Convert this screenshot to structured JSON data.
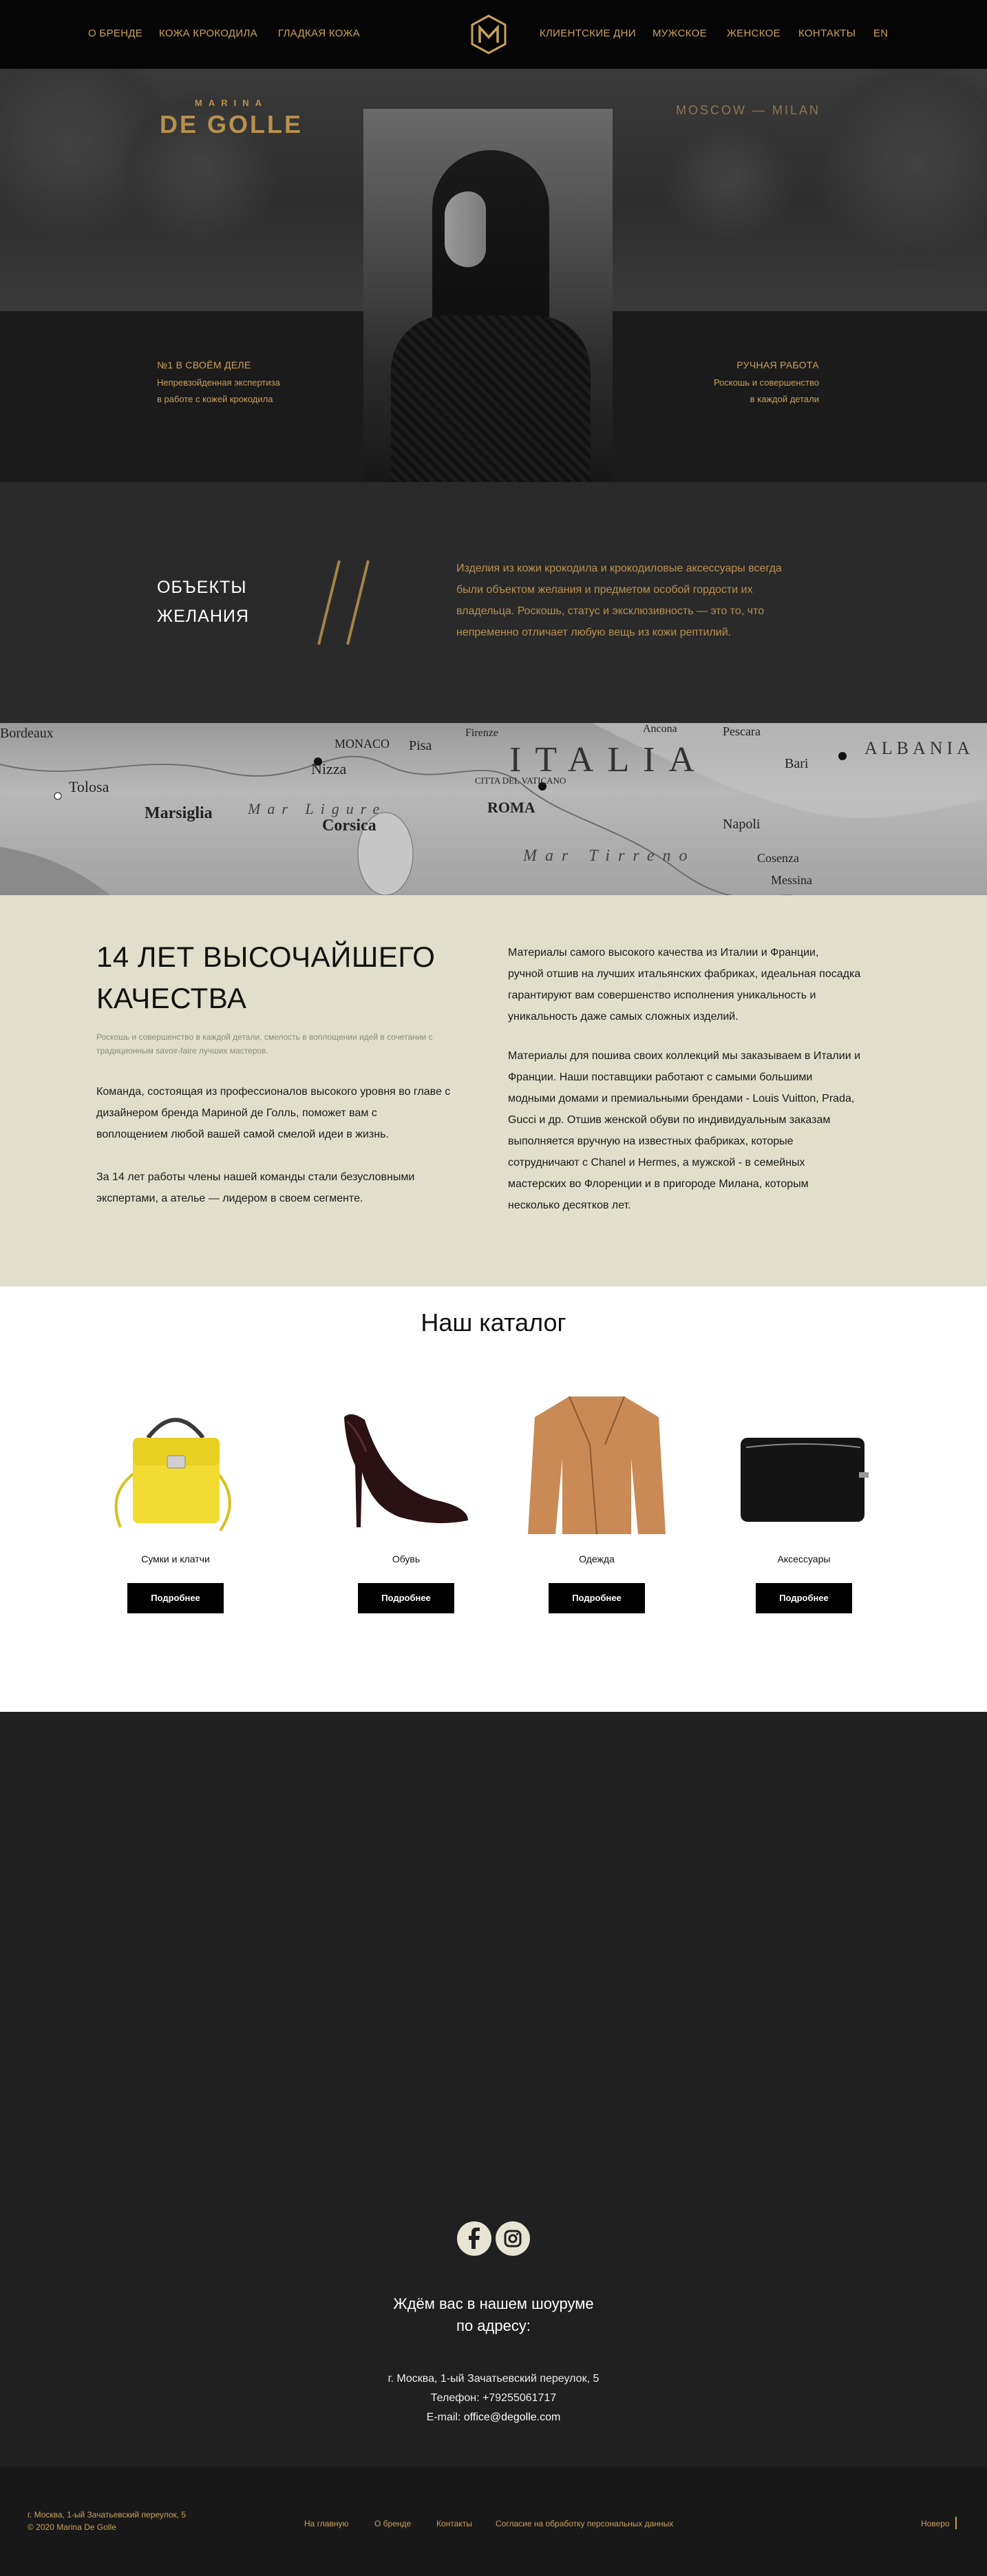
{
  "nav": {
    "left": [
      "О БРЕНДЕ",
      "КОЖА КРОКОДИЛА",
      "ГЛАДКАЯ КОЖА"
    ],
    "right": [
      "КЛИЕНТСКИЕ ДНИ",
      "МУЖСКОЕ",
      "ЖЕНСКОЕ",
      "КОНТАКТЫ",
      "EN"
    ],
    "logo_letter": "M"
  },
  "hero": {
    "brand_small": "MARINA",
    "brand_big": "DE GOLLE",
    "city": "MOSCOW — MILAN",
    "left_heading": "№1 В СВОЁМ ДЕЛЕ",
    "left_lines": [
      "Непревзойденная экспертиза",
      "в работе с кожей крокодила"
    ],
    "right_heading": "РУЧНАЯ РАБОТА",
    "right_lines": [
      "Роскошь и совершенство",
      "в каждой детали"
    ]
  },
  "objects": {
    "title_lines": [
      "ОБЪЕКТЫ",
      "ЖЕЛАНИЯ"
    ],
    "text_lines": [
      "Изделия из кожи крокодила и крокодиловые аксессуары всегда",
      "были объектом желания и предметом особой гордости их",
      "владельца. Роскошь, статус и эксклюзивность — это то, что",
      "непременно отличает любую вещь из кожи рептилий."
    ]
  },
  "map": {
    "labels": [
      "Bordeaux",
      "Tolosa",
      "Marsiglia",
      "MONACO",
      "Nizza",
      "Pisa",
      "ITALIA",
      "Corsica",
      "ROMA",
      "Napoli",
      "Bari",
      "Pescara",
      "ALBANIA",
      "Cosenza",
      "Messina",
      "Mar Tirreno",
      "Mar Ligure",
      "CITTA DEL VATICANO",
      "Firenze",
      "Ancona"
    ]
  },
  "quality": {
    "title_lines": [
      "14 ЛЕТ ВЫСОЧАЙШЕГО",
      "КАЧЕСТВА"
    ],
    "subtitle_lines": [
      "Роскошь и совершенство в каждой детали, смелость в воплощении идей в сочетании с",
      "традиционным savoir-faire лучших мастеров."
    ],
    "left_p1": [
      "Команда, состоящая из профессионалов высокого уровня во главе с",
      "дизайнером бренда Мариной де Голль, поможет вам с",
      "воплощением любой вашей самой смелой идеи в жизнь."
    ],
    "left_p2": [
      "За 14 лет работы члены нашей команды стали безусловными",
      "экспертами, а ателье — лидером в своем сегменте."
    ],
    "right_p1": [
      "Материалы самого высокого качества из Италии и Франции,",
      "ручной отшив на лучших итальянских фабриках, идеальная посадка",
      "гарантируют вам совершенство исполнения уникальность и",
      "уникальность даже самых сложных изделий."
    ],
    "right_p2": [
      "Материалы для пошива своих коллекций мы заказываем в Италии и",
      "Франции. Наши поставщики работают с самыми большими",
      "модными домами и премиальными брендами - Louis Vuitton, Prada,",
      "Gucci и др. Отшив женской обуви по индивидуальным заказам",
      "выполняется вручную на известных фабриках, которые",
      "сотрудничают с Chanel и Hermes, а мужской - в семейных",
      "мастерских во Флоренции и в пригороде Милана, которым",
      "несколько десятков лет."
    ]
  },
  "catalog": {
    "title": "Наш каталог",
    "button_label": "Подробнее",
    "items": [
      {
        "label": "Сумки и клатчи",
        "icon": "bag-image"
      },
      {
        "label": "Обувь",
        "icon": "shoe-image"
      },
      {
        "label": "Одежда",
        "icon": "jacket-image"
      },
      {
        "label": "Аксессуары",
        "icon": "wallet-image"
      }
    ]
  },
  "contacts": {
    "heading_lines": [
      "Ждём вас в нашем шоуруме",
      "по адресу:"
    ],
    "address": "г. Москва, 1-ый Зачатьевский переулок, 5",
    "phone": "Телефон: +79255061717",
    "email_prefix": "E-mail: ",
    "email": "office@degolle.com",
    "social": [
      "facebook-icon",
      "instagram-icon"
    ]
  },
  "footer": {
    "address": "г. Москва, 1-ый Зачатьевский переулок, 5",
    "copyright": "© 2020 Marina De Golle",
    "links": [
      "На главную",
      "О бренде",
      "Контакты",
      "Согласие на обработку персональных данных"
    ],
    "credit": "Новеро"
  },
  "colors": {
    "gold": "#c9a15c",
    "dark": "#202020",
    "beige": "#e1dfcb"
  }
}
